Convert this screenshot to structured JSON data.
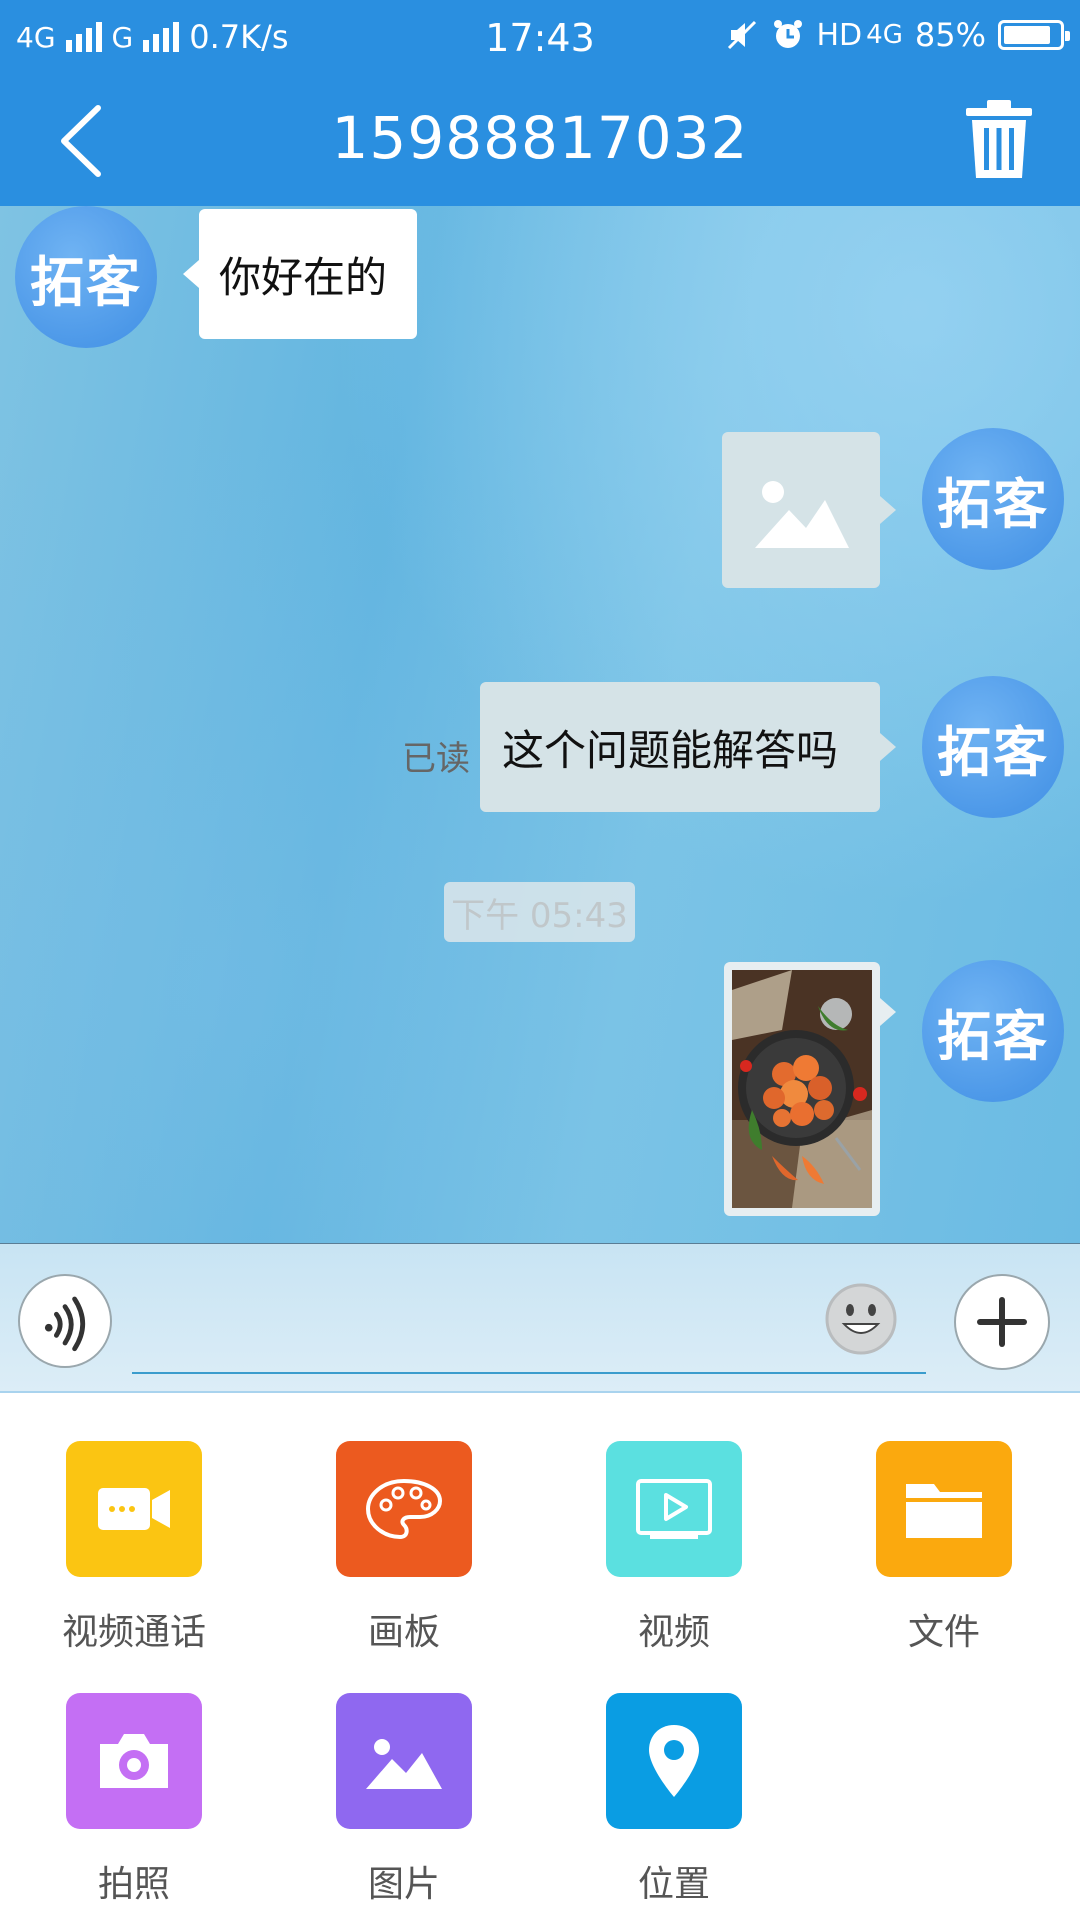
{
  "status_bar": {
    "network_1": "4G",
    "network_2": "G",
    "speed": "0.7K/s",
    "time": "17:43",
    "hd": "HD",
    "network_3": "4G",
    "battery": "85%",
    "battery_level": 0.85
  },
  "header": {
    "title": "15988817032"
  },
  "messages": [
    {
      "side": "incoming",
      "type": "text",
      "avatar": "拓客",
      "text": "你好在的"
    },
    {
      "side": "outgoing",
      "type": "image-placeholder",
      "avatar": "拓客"
    },
    {
      "side": "outgoing",
      "type": "text",
      "avatar": "拓客",
      "text": "这个问题能解答吗",
      "status": "已读"
    },
    {
      "side": "outgoing",
      "type": "photo",
      "avatar": "拓客"
    }
  ],
  "timestamp": "下午 05:43",
  "input": {
    "placeholder": ""
  },
  "actions": [
    {
      "label": "视频通话",
      "icon": "video-call-icon",
      "color": "#fbc512"
    },
    {
      "label": "画板",
      "icon": "palette-icon",
      "color": "#ec5a1f"
    },
    {
      "label": "视频",
      "icon": "video-play-icon",
      "color": "#5be0e0"
    },
    {
      "label": "文件",
      "icon": "folder-icon",
      "color": "#fba90e"
    },
    {
      "label": "拍照",
      "icon": "camera-icon",
      "color": "#c46ff4"
    },
    {
      "label": "图片",
      "icon": "picture-icon",
      "color": "#8f68f0"
    },
    {
      "label": "位置",
      "icon": "location-pin-icon",
      "color": "#0a9de3"
    }
  ]
}
